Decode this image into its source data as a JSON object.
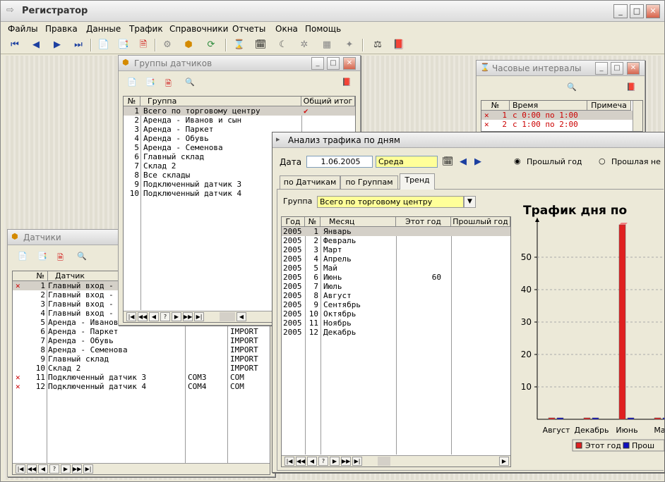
{
  "app": {
    "title": "Регистратор"
  },
  "menu": [
    "Файлы",
    "Правка",
    "Данные",
    "Трафик",
    "Справочники",
    "Отчеты",
    "Окна",
    "Помощь"
  ],
  "groups_window": {
    "title": "Группы датчиков",
    "headers": [
      "№",
      "Группа",
      "Общий итог"
    ],
    "rows": [
      {
        "n": "1",
        "name": "Всего по торговому центру",
        "total": "✔"
      },
      {
        "n": "2",
        "name": "Аренда - Иванов и сын",
        "total": ""
      },
      {
        "n": "3",
        "name": "Аренда - Паркет",
        "total": ""
      },
      {
        "n": "4",
        "name": "Аренда - Обувь",
        "total": ""
      },
      {
        "n": "5",
        "name": "Аренда - Семенова",
        "total": ""
      },
      {
        "n": "6",
        "name": "Главный склад",
        "total": ""
      },
      {
        "n": "7",
        "name": "Склад 2",
        "total": ""
      },
      {
        "n": "8",
        "name": "Все склады",
        "total": ""
      },
      {
        "n": "9",
        "name": "Подключенный датчик 3",
        "total": ""
      },
      {
        "n": "10",
        "name": "Подключенный датчик 4",
        "total": ""
      }
    ]
  },
  "sensors_window": {
    "title": "Датчики",
    "headers": [
      "№",
      "Датчик"
    ],
    "rows": [
      {
        "mark": "✕",
        "n": "1",
        "name": "Главный вход - в",
        "port": "",
        "type": ""
      },
      {
        "mark": "",
        "n": "2",
        "name": "Главный вход - в",
        "port": "",
        "type": ""
      },
      {
        "mark": "",
        "n": "3",
        "name": "Главный вход - м",
        "port": "",
        "type": ""
      },
      {
        "mark": "",
        "n": "4",
        "name": "Главный вход - з",
        "port": "",
        "type": ""
      },
      {
        "mark": "",
        "n": "5",
        "name": "Аренда - Иванов",
        "port": "",
        "type": ""
      },
      {
        "mark": "",
        "n": "6",
        "name": "Аренда - Паркет",
        "port": "",
        "type": "IMPORT"
      },
      {
        "mark": "",
        "n": "7",
        "name": "Аренда - Обувь",
        "port": "",
        "type": "IMPORT"
      },
      {
        "mark": "",
        "n": "8",
        "name": "Аренда - Семенова",
        "port": "",
        "type": "IMPORT"
      },
      {
        "mark": "",
        "n": "9",
        "name": "Главный склад",
        "port": "",
        "type": "IMPORT"
      },
      {
        "mark": "",
        "n": "10",
        "name": "Склад 2",
        "port": "",
        "type": "IMPORT"
      },
      {
        "mark": "✕",
        "n": "11",
        "name": "Подключенный датчик 3",
        "port": "COM3",
        "type": "COM"
      },
      {
        "mark": "✕",
        "n": "12",
        "name": "Подключенный датчик 4",
        "port": "COM4",
        "type": "COM"
      }
    ]
  },
  "hours_window": {
    "title": "Часовые интервалы",
    "headers": [
      "№",
      "Время",
      "Примеча"
    ],
    "rows": [
      {
        "n": "1",
        "time": "с 0:00 по 1:00"
      },
      {
        "n": "2",
        "time": "с 1:00 по 2:00"
      }
    ]
  },
  "traffic_window": {
    "title": "Анализ трафика по дням",
    "date_label": "Дата",
    "date_value": "1.06.2005",
    "weekday": "Среда",
    "radio_prev_year": "Прошлый год",
    "radio_prev_week": "Прошлая не",
    "tabs": [
      "по Датчикам",
      "по Группам",
      "Тренд"
    ],
    "group_label": "Группа",
    "group_value": "Всего по торговому центру",
    "table_headers": [
      "Год",
      "№",
      "Месяц",
      "Этот год",
      "Прошлый год"
    ],
    "table_rows": [
      {
        "year": "2005",
        "n": "1",
        "month": "Январь",
        "this": "",
        "prev": ""
      },
      {
        "year": "2005",
        "n": "2",
        "month": "Февраль",
        "this": "",
        "prev": ""
      },
      {
        "year": "2005",
        "n": "3",
        "month": "Март",
        "this": "",
        "prev": ""
      },
      {
        "year": "2005",
        "n": "4",
        "month": "Апрель",
        "this": "",
        "prev": ""
      },
      {
        "year": "2005",
        "n": "5",
        "month": "Май",
        "this": "",
        "prev": ""
      },
      {
        "year": "2005",
        "n": "6",
        "month": "Июнь",
        "this": "60",
        "prev": ""
      },
      {
        "year": "2005",
        "n": "7",
        "month": "Июль",
        "this": "",
        "prev": ""
      },
      {
        "year": "2005",
        "n": "8",
        "month": "Август",
        "this": "",
        "prev": ""
      },
      {
        "year": "2005",
        "n": "9",
        "month": "Сентябрь",
        "this": "",
        "prev": ""
      },
      {
        "year": "2005",
        "n": "10",
        "month": "Октябрь",
        "this": "",
        "prev": ""
      },
      {
        "year": "2005",
        "n": "11",
        "month": "Ноябрь",
        "this": "",
        "prev": ""
      },
      {
        "year": "2005",
        "n": "12",
        "month": "Декабрь",
        "this": "",
        "prev": ""
      }
    ]
  },
  "chart_data": {
    "type": "bar",
    "title": "Трафик дня по",
    "categories": [
      "Август",
      "Декабрь",
      "Июнь",
      "Мар"
    ],
    "series": [
      {
        "name": "Этот год",
        "color": "#e02020",
        "values": [
          0,
          0,
          60,
          0
        ]
      },
      {
        "name": "Прош",
        "color": "#1010c0",
        "values": [
          0,
          0,
          0,
          0
        ]
      }
    ],
    "yticks": [
      10,
      20,
      30,
      40,
      50
    ],
    "ylim": [
      0,
      60
    ],
    "grid": true,
    "legend": "bottom"
  },
  "nav_buttons": [
    "|◀",
    "◀◀",
    "◀",
    "?",
    "▶",
    "▶▶",
    "▶|"
  ]
}
